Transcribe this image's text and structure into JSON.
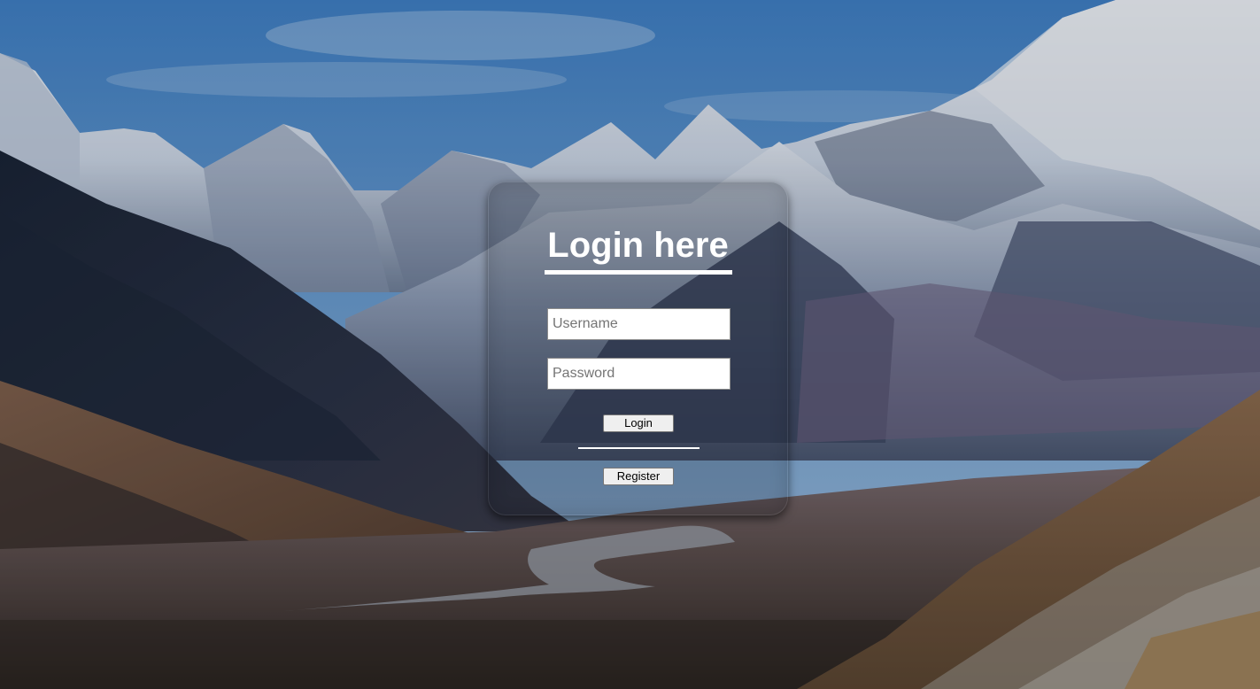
{
  "login": {
    "title": "Login here",
    "username_placeholder": "Username",
    "password_placeholder": "Password",
    "login_label": "Login",
    "register_label": "Register"
  },
  "colors": {
    "title": "#ffffff",
    "underline": "#ffffff",
    "card_tint": "rgba(12,18,30,0.18)"
  },
  "background": {
    "icon": "mountain-valley-photo"
  }
}
